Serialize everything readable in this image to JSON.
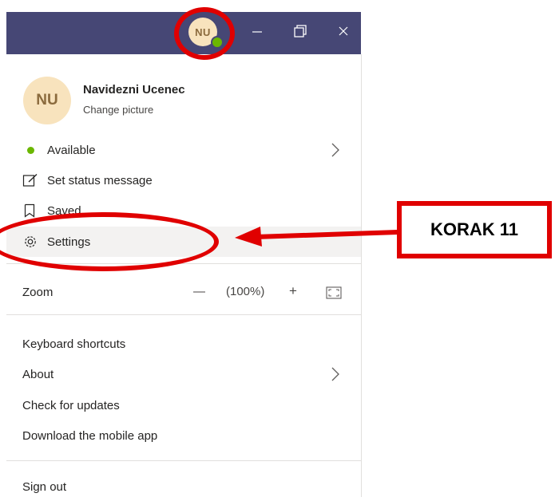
{
  "titlebar": {
    "avatar_initials": "NU",
    "presence_color": "#6bb700",
    "bg_color": "#464775",
    "controls": [
      "minimize-icon",
      "restore-icon",
      "close-icon"
    ]
  },
  "profile": {
    "initials": "NU",
    "name": "Navidezni Ucenec",
    "change_picture": "Change picture"
  },
  "menu": {
    "status_label": "Available",
    "set_status": "Set status message",
    "saved": "Saved",
    "settings": "Settings",
    "zoom_label": "Zoom",
    "zoom_minus": "—",
    "zoom_value": "(100%)",
    "zoom_plus": "+",
    "keyboard_shortcuts": "Keyboard shortcuts",
    "about": "About",
    "check_updates": "Check for updates",
    "download_app": "Download the mobile app",
    "sign_out": "Sign out"
  },
  "annotation": {
    "callout_text": "KORAK 11",
    "color": "#e00000"
  }
}
